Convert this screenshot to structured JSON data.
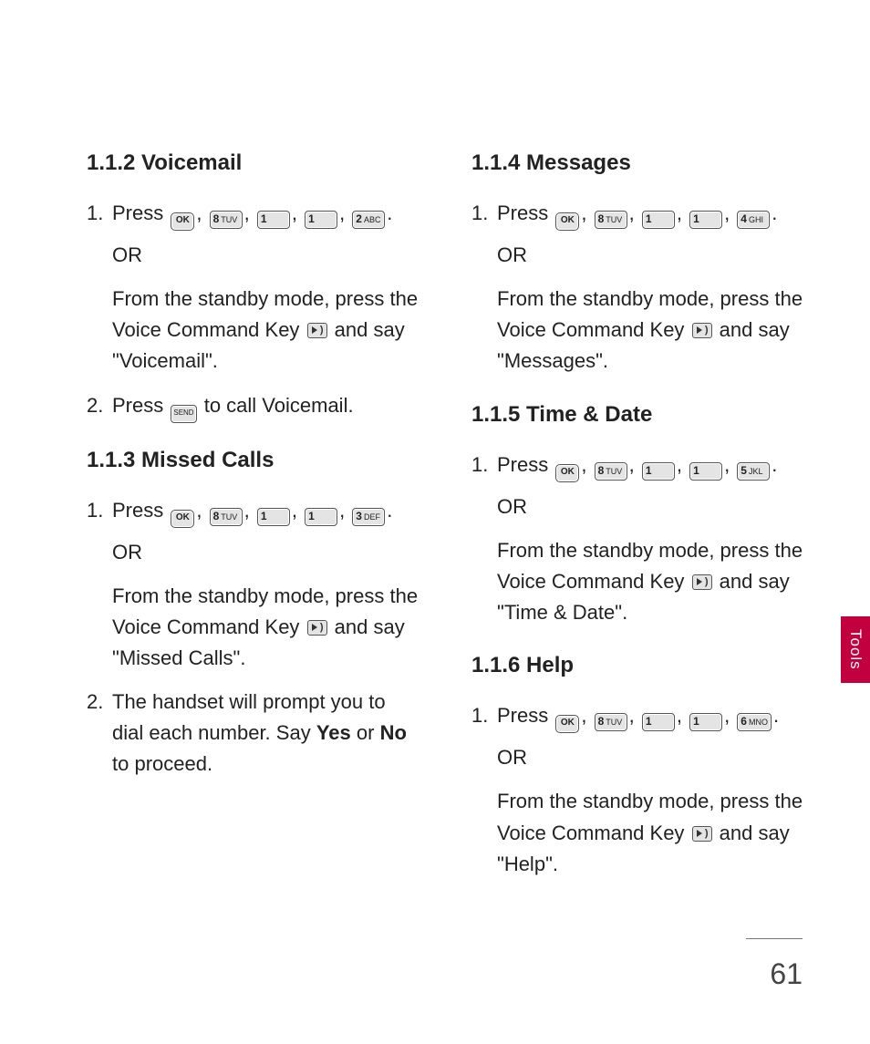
{
  "sidebar": {
    "tab_label": "Tools"
  },
  "page_number": "61",
  "keys": {
    "ok": "OK",
    "k8": {
      "digit": "8",
      "sub": "TUV"
    },
    "k1": {
      "digit": "1",
      "sub": ""
    },
    "k2": {
      "digit": "2",
      "sub": "ABC"
    },
    "k3": {
      "digit": "3",
      "sub": "DEF"
    },
    "k4": {
      "digit": "4",
      "sub": "GHI"
    },
    "k5": {
      "digit": "5",
      "sub": "JKL"
    },
    "k6": {
      "digit": "6",
      "sub": "MNO"
    },
    "send": "SEND"
  },
  "common": {
    "or": "OR",
    "press_prefix": "Press ",
    "standby_prefix": "From the standby mode, press the Voice Command Key ",
    "and_say_prefix": " and say \"",
    "quote_close": "\"."
  },
  "sections": {
    "voicemail": {
      "title": "1.1.2 Voicemail",
      "say": "Voicemail",
      "step2": "Press ",
      "step2_after": " to call Voicemail."
    },
    "missed": {
      "title": "1.1.3 Missed Calls",
      "say": "Missed Calls",
      "step2a": "The handset will prompt you to dial each number. Say ",
      "step2_yes": "Yes",
      "step2_or": " or ",
      "step2_no": "No",
      "step2b": " to proceed."
    },
    "messages": {
      "title": "1.1.4 Messages",
      "say": "Messages"
    },
    "timedate": {
      "title": "1.1.5 Time & Date",
      "say": "Time & Date"
    },
    "help": {
      "title": "1.1.6 Help",
      "say": "Help"
    }
  }
}
